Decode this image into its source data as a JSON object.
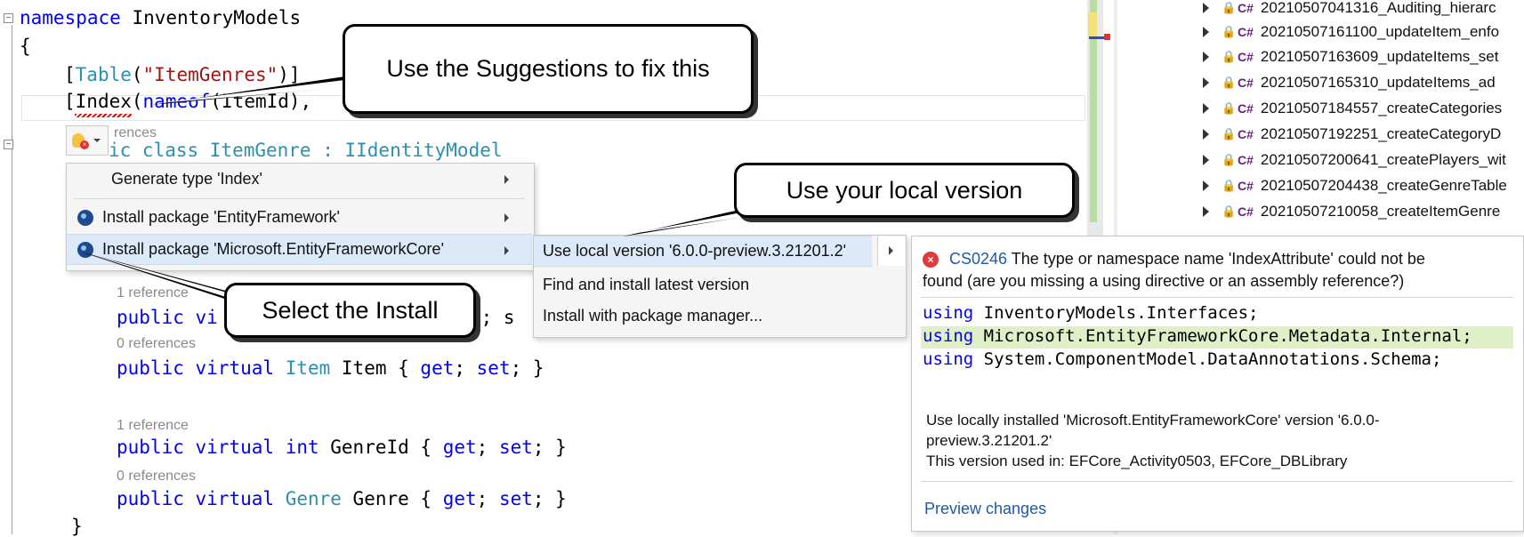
{
  "editor": {
    "lines": {
      "namespace_kw": "namespace",
      "namespace_name": "InventoryModels",
      "open_brace": "{",
      "table_attr_open": "[",
      "table_attr_type": "Table",
      "table_attr_paren": "(",
      "table_attr_str": "\"ItemGenres\"",
      "table_attr_close": ")]",
      "index_attr_open": "[",
      "index_attr_name": "Index",
      "index_attr_paren": "(",
      "index_attr_nameof": "nameof",
      "index_attr_arg": "(ItemId),",
      "index_attr_end": "]",
      "class_partial": "ic class ItemGenre : IIdentityModel",
      "refs_partial": "rences",
      "ref1": "1 reference",
      "prop1_partial_a": "public vi",
      "prop1_partial_b": "t; s",
      "ref0a": "0 references",
      "prop2_public": "public",
      "prop2_virtual": "virtual",
      "prop2_type": "Item",
      "prop2_rest": " Item { ",
      "prop2_get": "get",
      "prop2_semi": "; ",
      "prop2_set": "set",
      "prop2_end": "; }",
      "ref1b": "1 reference",
      "prop3_public": "public",
      "prop3_virtual": "virtual",
      "prop3_int": "int",
      "prop3_rest": " GenreId { ",
      "prop3_get": "get",
      "prop3_set": "set",
      "ref0b": "0 references",
      "prop4_public": "public",
      "prop4_virtual": "virtual",
      "prop4_type": "Genre",
      "prop4_rest": " Genre { ",
      "prop4_get": "get",
      "prop4_set": "set",
      "close_brace": "}"
    }
  },
  "explorer": {
    "items": [
      "20210507041316_Auditing_hierarc",
      "20210507161100_updateItem_enfo",
      "20210507163609_updateItems_set",
      "20210507165310_updateItems_ad",
      "20210507184557_createCategories",
      "20210507192251_createCategoryD",
      "20210507200641_createPlayers_wit",
      "20210507204438_createGenreTable",
      "20210507210058_createItemGenre"
    ],
    "cs_label": "C#"
  },
  "quick_actions": {
    "items": [
      "Generate type 'Index'",
      "Install package 'EntityFramework'",
      "Install package 'Microsoft.EntityFrameworkCore'"
    ]
  },
  "submenu": {
    "items": [
      "Use local version '6.0.0-preview.3.21201.2'",
      "Find and install latest version",
      "Install with package manager..."
    ]
  },
  "preview": {
    "error_code": "CS0246",
    "error_text_1": " The type or namespace name 'IndexAttribute' could not be",
    "error_text_2": "found (are you missing a using directive or an assembly reference?)",
    "using_kw": "using",
    "using_1": " InventoryModels.Interfaces;",
    "using_2": " Microsoft.EntityFrameworkCore.Metadata.Internal;",
    "using_3": " System.ComponentModel.DataAnnotations.Schema;",
    "desc_1": "Use locally installed 'Microsoft.EntityFrameworkCore' version '6.0.0-",
    "desc_2": "preview.3.21201.2'",
    "desc_3": "This version used in: EFCore_Activity0503, EFCore_DBLibrary",
    "preview_link": "Preview changes"
  },
  "callouts": {
    "suggestions": "Use the Suggestions to fix this",
    "local": "Use your local version",
    "install": "Select the Install"
  },
  "colors": {
    "keyword": "#0000ff",
    "type": "#2b91af",
    "string": "#a31515",
    "menu_highlight": "#dbe9f8",
    "added_line": "#dff0c8",
    "link": "#1e5aa8"
  }
}
